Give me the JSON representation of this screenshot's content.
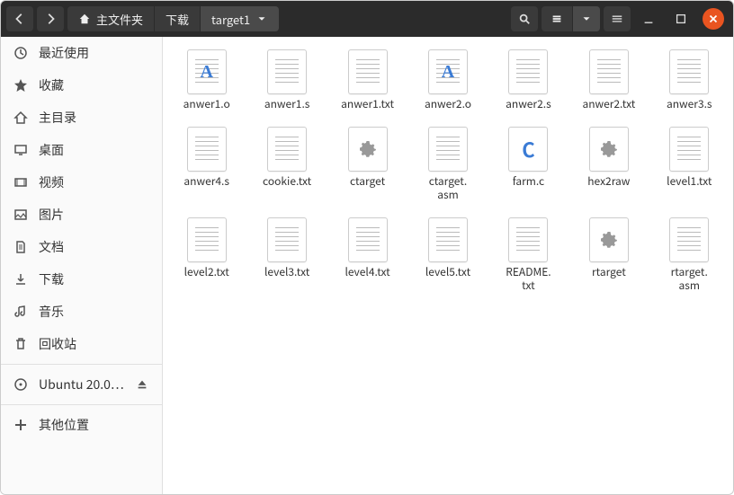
{
  "breadcrumb": {
    "root": "主文件夹",
    "middle": "下载",
    "current": "target1"
  },
  "sidebar": {
    "items": [
      {
        "label": "最近使用",
        "icon": "clock"
      },
      {
        "label": "收藏",
        "icon": "star"
      },
      {
        "label": "主目录",
        "icon": "home"
      },
      {
        "label": "桌面",
        "icon": "desktop"
      },
      {
        "label": "视频",
        "icon": "video"
      },
      {
        "label": "图片",
        "icon": "image"
      },
      {
        "label": "文档",
        "icon": "document"
      },
      {
        "label": "下载",
        "icon": "download"
      },
      {
        "label": "音乐",
        "icon": "music"
      },
      {
        "label": "回收站",
        "icon": "trash"
      }
    ],
    "mount": {
      "label": "Ubuntu 20.0…",
      "icon": "disc"
    },
    "other": {
      "label": "其他位置",
      "icon": "plus"
    }
  },
  "files": [
    {
      "name": "anwer1.o",
      "thumb": "doc-a"
    },
    {
      "name": "anwer1.s",
      "thumb": "text"
    },
    {
      "name": "anwer1.txt",
      "thumb": "text"
    },
    {
      "name": "anwer2.o",
      "thumb": "doc-a"
    },
    {
      "name": "anwer2.s",
      "thumb": "text"
    },
    {
      "name": "anwer2.txt",
      "thumb": "text"
    },
    {
      "name": "anwer3.s",
      "thumb": "text"
    },
    {
      "name": "anwer4.s",
      "thumb": "text"
    },
    {
      "name": "cookie.txt",
      "thumb": "text"
    },
    {
      "name": "ctarget",
      "thumb": "gear"
    },
    {
      "name": "ctarget.\nasm",
      "thumb": "text"
    },
    {
      "name": "farm.c",
      "thumb": "doc-c"
    },
    {
      "name": "hex2raw",
      "thumb": "gear"
    },
    {
      "name": "level1.txt",
      "thumb": "text"
    },
    {
      "name": "level2.txt",
      "thumb": "text"
    },
    {
      "name": "level3.txt",
      "thumb": "text"
    },
    {
      "name": "level4.txt",
      "thumb": "text"
    },
    {
      "name": "level5.txt",
      "thumb": "text"
    },
    {
      "name": "README.\ntxt",
      "thumb": "text"
    },
    {
      "name": "rtarget",
      "thumb": "gear"
    },
    {
      "name": "rtarget.\nasm",
      "thumb": "text"
    }
  ]
}
